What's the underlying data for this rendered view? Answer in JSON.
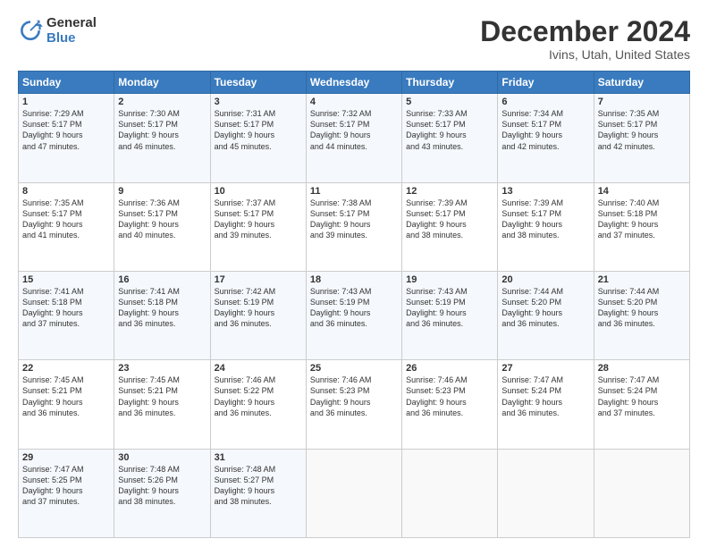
{
  "logo": {
    "general": "General",
    "blue": "Blue"
  },
  "title": "December 2024",
  "subtitle": "Ivins, Utah, United States",
  "days_header": [
    "Sunday",
    "Monday",
    "Tuesday",
    "Wednesday",
    "Thursday",
    "Friday",
    "Saturday"
  ],
  "weeks": [
    [
      {
        "day": "1",
        "sunrise": "7:29 AM",
        "sunset": "5:17 PM",
        "daylight": "9 hours and 47 minutes."
      },
      {
        "day": "2",
        "sunrise": "7:30 AM",
        "sunset": "5:17 PM",
        "daylight": "9 hours and 46 minutes."
      },
      {
        "day": "3",
        "sunrise": "7:31 AM",
        "sunset": "5:17 PM",
        "daylight": "9 hours and 45 minutes."
      },
      {
        "day": "4",
        "sunrise": "7:32 AM",
        "sunset": "5:17 PM",
        "daylight": "9 hours and 44 minutes."
      },
      {
        "day": "5",
        "sunrise": "7:33 AM",
        "sunset": "5:17 PM",
        "daylight": "9 hours and 43 minutes."
      },
      {
        "day": "6",
        "sunrise": "7:34 AM",
        "sunset": "5:17 PM",
        "daylight": "9 hours and 42 minutes."
      },
      {
        "day": "7",
        "sunrise": "7:35 AM",
        "sunset": "5:17 PM",
        "daylight": "9 hours and 42 minutes."
      }
    ],
    [
      {
        "day": "8",
        "sunrise": "7:35 AM",
        "sunset": "5:17 PM",
        "daylight": "9 hours and 41 minutes."
      },
      {
        "day": "9",
        "sunrise": "7:36 AM",
        "sunset": "5:17 PM",
        "daylight": "9 hours and 40 minutes."
      },
      {
        "day": "10",
        "sunrise": "7:37 AM",
        "sunset": "5:17 PM",
        "daylight": "9 hours and 39 minutes."
      },
      {
        "day": "11",
        "sunrise": "7:38 AM",
        "sunset": "5:17 PM",
        "daylight": "9 hours and 39 minutes."
      },
      {
        "day": "12",
        "sunrise": "7:39 AM",
        "sunset": "5:17 PM",
        "daylight": "9 hours and 38 minutes."
      },
      {
        "day": "13",
        "sunrise": "7:39 AM",
        "sunset": "5:17 PM",
        "daylight": "9 hours and 38 minutes."
      },
      {
        "day": "14",
        "sunrise": "7:40 AM",
        "sunset": "5:18 PM",
        "daylight": "9 hours and 37 minutes."
      }
    ],
    [
      {
        "day": "15",
        "sunrise": "7:41 AM",
        "sunset": "5:18 PM",
        "daylight": "9 hours and 37 minutes."
      },
      {
        "day": "16",
        "sunrise": "7:41 AM",
        "sunset": "5:18 PM",
        "daylight": "9 hours and 36 minutes."
      },
      {
        "day": "17",
        "sunrise": "7:42 AM",
        "sunset": "5:19 PM",
        "daylight": "9 hours and 36 minutes."
      },
      {
        "day": "18",
        "sunrise": "7:43 AM",
        "sunset": "5:19 PM",
        "daylight": "9 hours and 36 minutes."
      },
      {
        "day": "19",
        "sunrise": "7:43 AM",
        "sunset": "5:19 PM",
        "daylight": "9 hours and 36 minutes."
      },
      {
        "day": "20",
        "sunrise": "7:44 AM",
        "sunset": "5:20 PM",
        "daylight": "9 hours and 36 minutes."
      },
      {
        "day": "21",
        "sunrise": "7:44 AM",
        "sunset": "5:20 PM",
        "daylight": "9 hours and 36 minutes."
      }
    ],
    [
      {
        "day": "22",
        "sunrise": "7:45 AM",
        "sunset": "5:21 PM",
        "daylight": "9 hours and 36 minutes."
      },
      {
        "day": "23",
        "sunrise": "7:45 AM",
        "sunset": "5:21 PM",
        "daylight": "9 hours and 36 minutes."
      },
      {
        "day": "24",
        "sunrise": "7:46 AM",
        "sunset": "5:22 PM",
        "daylight": "9 hours and 36 minutes."
      },
      {
        "day": "25",
        "sunrise": "7:46 AM",
        "sunset": "5:23 PM",
        "daylight": "9 hours and 36 minutes."
      },
      {
        "day": "26",
        "sunrise": "7:46 AM",
        "sunset": "5:23 PM",
        "daylight": "9 hours and 36 minutes."
      },
      {
        "day": "27",
        "sunrise": "7:47 AM",
        "sunset": "5:24 PM",
        "daylight": "9 hours and 36 minutes."
      },
      {
        "day": "28",
        "sunrise": "7:47 AM",
        "sunset": "5:24 PM",
        "daylight": "9 hours and 37 minutes."
      }
    ],
    [
      {
        "day": "29",
        "sunrise": "7:47 AM",
        "sunset": "5:25 PM",
        "daylight": "9 hours and 37 minutes."
      },
      {
        "day": "30",
        "sunrise": "7:48 AM",
        "sunset": "5:26 PM",
        "daylight": "9 hours and 38 minutes."
      },
      {
        "day": "31",
        "sunrise": "7:48 AM",
        "sunset": "5:27 PM",
        "daylight": "9 hours and 38 minutes."
      },
      null,
      null,
      null,
      null
    ]
  ]
}
